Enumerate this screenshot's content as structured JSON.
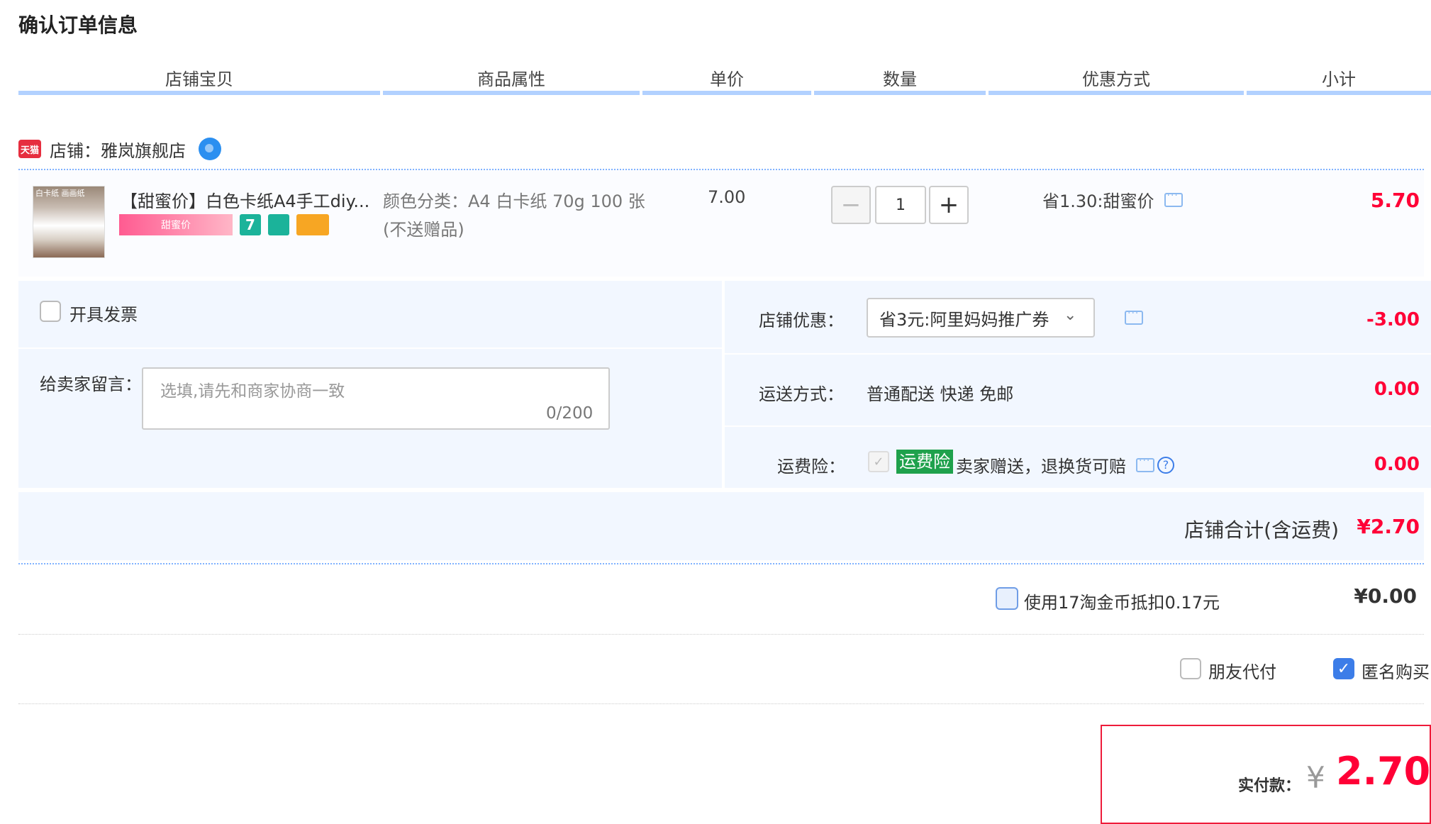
{
  "page_title": "确认订单信息",
  "columns": [
    "店铺宝贝",
    "商品属性",
    "单价",
    "数量",
    "优惠方式",
    "小计"
  ],
  "shop": {
    "badge": "天猫",
    "label": "店铺：雅岚旗舰店"
  },
  "item": {
    "thumb_tag": "白卡纸 画画纸",
    "title": "【甜蜜价】白色卡纸A4手工diy...",
    "badge_text": "甜蜜价",
    "badge_seven": "7",
    "attributes": "颜色分类：A4 白卡纸 70g 100 张(不送赠品)",
    "unit_price": "7.00",
    "quantity": "1",
    "minus": "−",
    "plus": "+",
    "discount": "省1.30:甜蜜价",
    "subtotal": "5.70"
  },
  "options": {
    "invoice_label": "开具发票",
    "message_label": "给卖家留言：",
    "message_placeholder": "选填,请先和商家协商一致",
    "message_count": "0/200",
    "shop_discount_label": "店铺优惠：",
    "shop_discount_value": "省3元:阿里妈妈推广券",
    "shop_discount_amount": "-3.00",
    "shipping_label": "运送方式：",
    "shipping_value": "普通配送 快递 免邮",
    "shipping_amount": "0.00",
    "insurance_label": "运费险：",
    "insurance_badge": "运费险",
    "insurance_desc": "卖家赠送，退换货可赔",
    "insurance_amount": "0.00"
  },
  "shop_total": {
    "label": "店铺合计(含运费)",
    "amount": "¥2.70"
  },
  "coins": {
    "label": "使用17淘金币抵扣0.17元",
    "amount": "¥0.00"
  },
  "friend_pay_label": "朋友代付",
  "anonymous_label": "匿名购买",
  "payment": {
    "label": "实付款：",
    "currency": "¥",
    "amount": "2.70"
  },
  "colors": {
    "accent_red": "#ff0036",
    "header_line": "#b2d1ff",
    "panel_bg": "#f2f7ff",
    "check_blue": "#3c7de8",
    "insurance_green": "#1fa14c"
  },
  "icons": [
    "tmall-icon",
    "wangwang-icon",
    "chat-icon",
    "chevron-down-icon",
    "check-icon",
    "help-icon"
  ]
}
